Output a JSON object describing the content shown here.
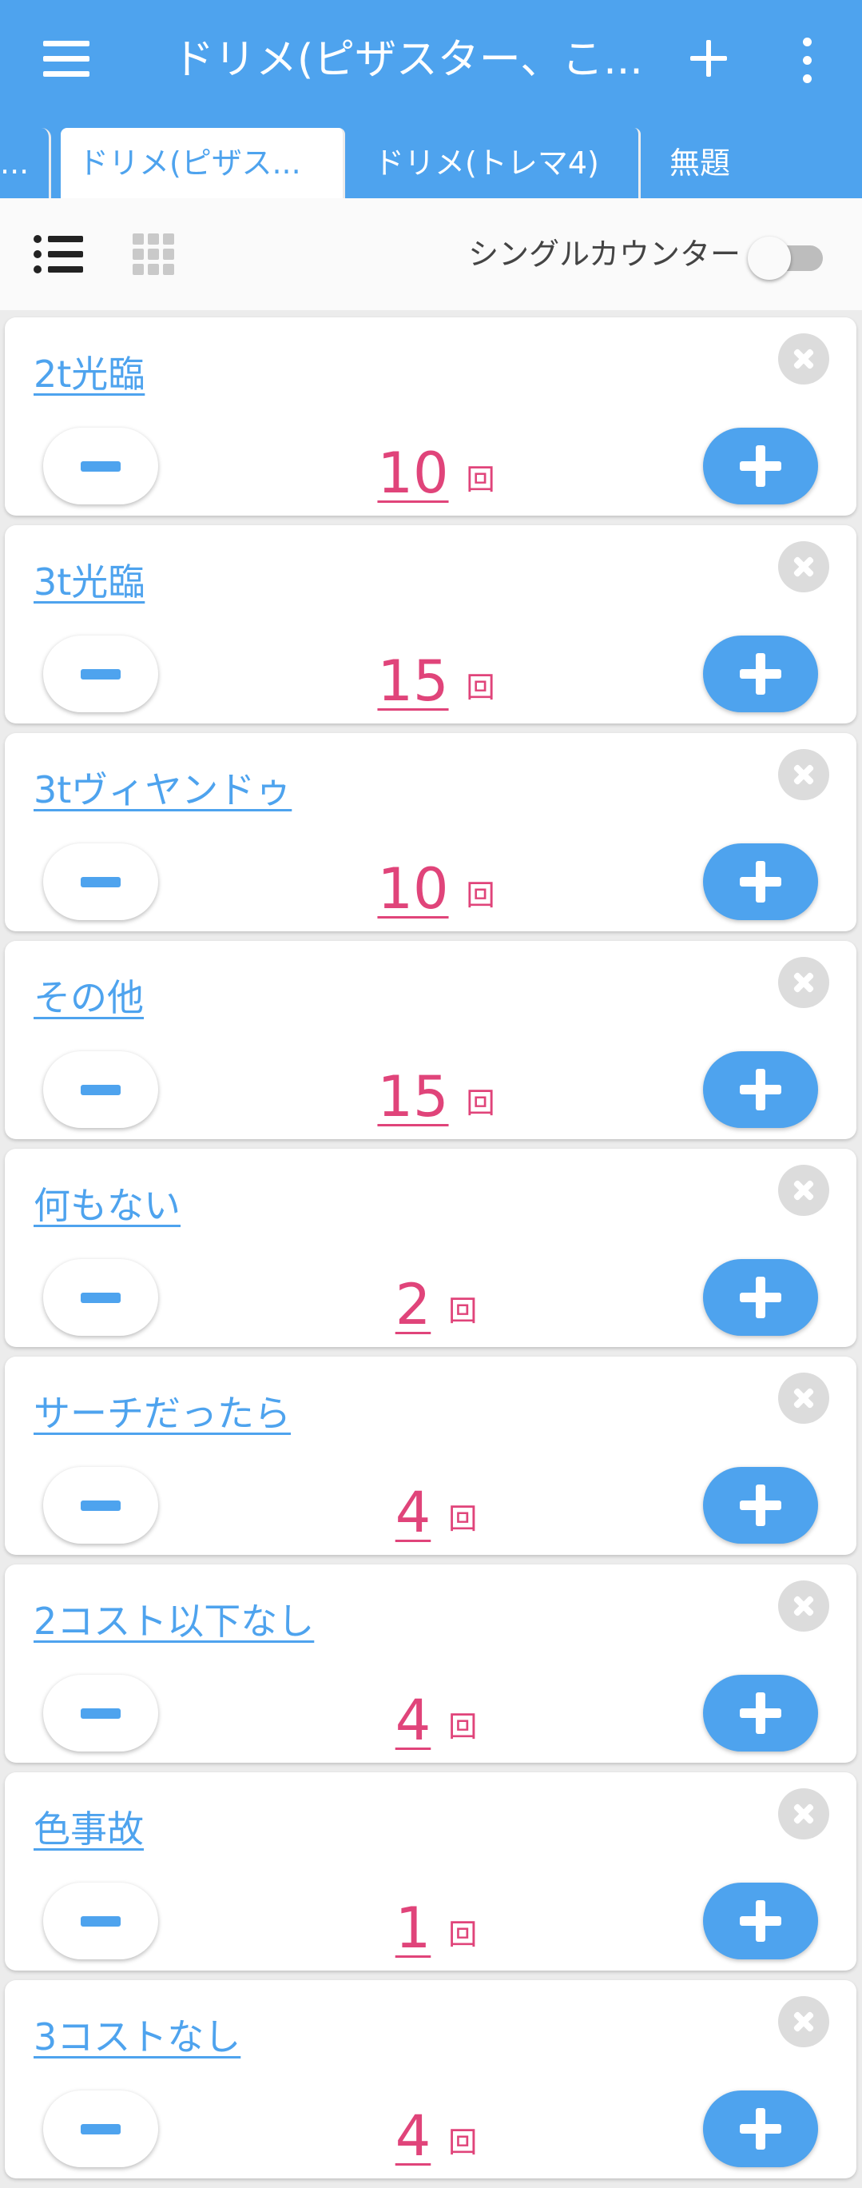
{
  "appbar": {
    "title": "ドリメ(ピザスター、こ...",
    "menu_icon": "hamburger-menu-icon",
    "add_icon": "plus-icon",
    "more_icon": "more-vert-icon"
  },
  "tabs": [
    {
      "label": "..."
    },
    {
      "label": "ドリメ(ピザス..."
    },
    {
      "label": "ドリメ(トレマ4)"
    },
    {
      "label": "無題"
    }
  ],
  "toolbar": {
    "list_icon": "list-view-icon",
    "grid_icon": "grid-view-icon",
    "single_counter_label": "シングルカウンター",
    "single_counter_on": false
  },
  "counters": [
    {
      "name": "2t光臨",
      "count": "10",
      "unit": "回"
    },
    {
      "name": "3t光臨",
      "count": "15",
      "unit": "回"
    },
    {
      "name": "3tヴィヤンドゥ",
      "count": "10",
      "unit": "回"
    },
    {
      "name": "その他",
      "count": "15",
      "unit": "回"
    },
    {
      "name": "何もない",
      "count": "2",
      "unit": "回"
    },
    {
      "name": "サーチだったら",
      "count": "4",
      "unit": "回"
    },
    {
      "name": "2コスト以下なし",
      "count": "4",
      "unit": "回"
    },
    {
      "name": "色事故",
      "count": "1",
      "unit": "回"
    },
    {
      "name": "3コストなし",
      "count": "4",
      "unit": "回"
    }
  ],
  "colors": {
    "accent": "#4ea3ee",
    "count": "#e0447a",
    "background": "#ececec"
  }
}
